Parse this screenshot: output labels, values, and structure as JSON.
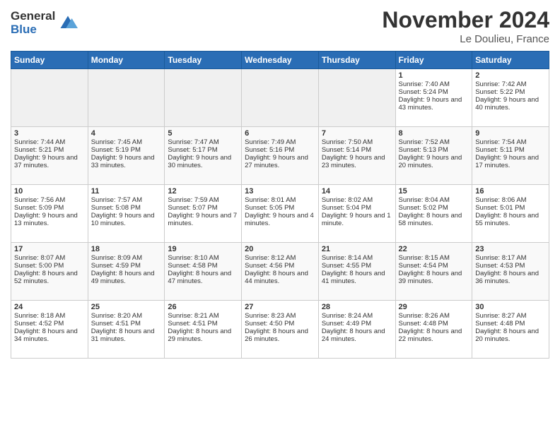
{
  "logo": {
    "general": "General",
    "blue": "Blue"
  },
  "header": {
    "month_year": "November 2024",
    "location": "Le Doulieu, France"
  },
  "days_of_week": [
    "Sunday",
    "Monday",
    "Tuesday",
    "Wednesday",
    "Thursday",
    "Friday",
    "Saturday"
  ],
  "weeks": [
    [
      {
        "day": "",
        "sunrise": "",
        "sunset": "",
        "daylight": "",
        "empty": true
      },
      {
        "day": "",
        "sunrise": "",
        "sunset": "",
        "daylight": "",
        "empty": true
      },
      {
        "day": "",
        "sunrise": "",
        "sunset": "",
        "daylight": "",
        "empty": true
      },
      {
        "day": "",
        "sunrise": "",
        "sunset": "",
        "daylight": "",
        "empty": true
      },
      {
        "day": "",
        "sunrise": "",
        "sunset": "",
        "daylight": "",
        "empty": true
      },
      {
        "day": "1",
        "sunrise": "Sunrise: 7:40 AM",
        "sunset": "Sunset: 5:24 PM",
        "daylight": "Daylight: 9 hours and 43 minutes.",
        "empty": false
      },
      {
        "day": "2",
        "sunrise": "Sunrise: 7:42 AM",
        "sunset": "Sunset: 5:22 PM",
        "daylight": "Daylight: 9 hours and 40 minutes.",
        "empty": false
      }
    ],
    [
      {
        "day": "3",
        "sunrise": "Sunrise: 7:44 AM",
        "sunset": "Sunset: 5:21 PM",
        "daylight": "Daylight: 9 hours and 37 minutes.",
        "empty": false
      },
      {
        "day": "4",
        "sunrise": "Sunrise: 7:45 AM",
        "sunset": "Sunset: 5:19 PM",
        "daylight": "Daylight: 9 hours and 33 minutes.",
        "empty": false
      },
      {
        "day": "5",
        "sunrise": "Sunrise: 7:47 AM",
        "sunset": "Sunset: 5:17 PM",
        "daylight": "Daylight: 9 hours and 30 minutes.",
        "empty": false
      },
      {
        "day": "6",
        "sunrise": "Sunrise: 7:49 AM",
        "sunset": "Sunset: 5:16 PM",
        "daylight": "Daylight: 9 hours and 27 minutes.",
        "empty": false
      },
      {
        "day": "7",
        "sunrise": "Sunrise: 7:50 AM",
        "sunset": "Sunset: 5:14 PM",
        "daylight": "Daylight: 9 hours and 23 minutes.",
        "empty": false
      },
      {
        "day": "8",
        "sunrise": "Sunrise: 7:52 AM",
        "sunset": "Sunset: 5:13 PM",
        "daylight": "Daylight: 9 hours and 20 minutes.",
        "empty": false
      },
      {
        "day": "9",
        "sunrise": "Sunrise: 7:54 AM",
        "sunset": "Sunset: 5:11 PM",
        "daylight": "Daylight: 9 hours and 17 minutes.",
        "empty": false
      }
    ],
    [
      {
        "day": "10",
        "sunrise": "Sunrise: 7:56 AM",
        "sunset": "Sunset: 5:09 PM",
        "daylight": "Daylight: 9 hours and 13 minutes.",
        "empty": false
      },
      {
        "day": "11",
        "sunrise": "Sunrise: 7:57 AM",
        "sunset": "Sunset: 5:08 PM",
        "daylight": "Daylight: 9 hours and 10 minutes.",
        "empty": false
      },
      {
        "day": "12",
        "sunrise": "Sunrise: 7:59 AM",
        "sunset": "Sunset: 5:07 PM",
        "daylight": "Daylight: 9 hours and 7 minutes.",
        "empty": false
      },
      {
        "day": "13",
        "sunrise": "Sunrise: 8:01 AM",
        "sunset": "Sunset: 5:05 PM",
        "daylight": "Daylight: 9 hours and 4 minutes.",
        "empty": false
      },
      {
        "day": "14",
        "sunrise": "Sunrise: 8:02 AM",
        "sunset": "Sunset: 5:04 PM",
        "daylight": "Daylight: 9 hours and 1 minute.",
        "empty": false
      },
      {
        "day": "15",
        "sunrise": "Sunrise: 8:04 AM",
        "sunset": "Sunset: 5:02 PM",
        "daylight": "Daylight: 8 hours and 58 minutes.",
        "empty": false
      },
      {
        "day": "16",
        "sunrise": "Sunrise: 8:06 AM",
        "sunset": "Sunset: 5:01 PM",
        "daylight": "Daylight: 8 hours and 55 minutes.",
        "empty": false
      }
    ],
    [
      {
        "day": "17",
        "sunrise": "Sunrise: 8:07 AM",
        "sunset": "Sunset: 5:00 PM",
        "daylight": "Daylight: 8 hours and 52 minutes.",
        "empty": false
      },
      {
        "day": "18",
        "sunrise": "Sunrise: 8:09 AM",
        "sunset": "Sunset: 4:59 PM",
        "daylight": "Daylight: 8 hours and 49 minutes.",
        "empty": false
      },
      {
        "day": "19",
        "sunrise": "Sunrise: 8:10 AM",
        "sunset": "Sunset: 4:58 PM",
        "daylight": "Daylight: 8 hours and 47 minutes.",
        "empty": false
      },
      {
        "day": "20",
        "sunrise": "Sunrise: 8:12 AM",
        "sunset": "Sunset: 4:56 PM",
        "daylight": "Daylight: 8 hours and 44 minutes.",
        "empty": false
      },
      {
        "day": "21",
        "sunrise": "Sunrise: 8:14 AM",
        "sunset": "Sunset: 4:55 PM",
        "daylight": "Daylight: 8 hours and 41 minutes.",
        "empty": false
      },
      {
        "day": "22",
        "sunrise": "Sunrise: 8:15 AM",
        "sunset": "Sunset: 4:54 PM",
        "daylight": "Daylight: 8 hours and 39 minutes.",
        "empty": false
      },
      {
        "day": "23",
        "sunrise": "Sunrise: 8:17 AM",
        "sunset": "Sunset: 4:53 PM",
        "daylight": "Daylight: 8 hours and 36 minutes.",
        "empty": false
      }
    ],
    [
      {
        "day": "24",
        "sunrise": "Sunrise: 8:18 AM",
        "sunset": "Sunset: 4:52 PM",
        "daylight": "Daylight: 8 hours and 34 minutes.",
        "empty": false
      },
      {
        "day": "25",
        "sunrise": "Sunrise: 8:20 AM",
        "sunset": "Sunset: 4:51 PM",
        "daylight": "Daylight: 8 hours and 31 minutes.",
        "empty": false
      },
      {
        "day": "26",
        "sunrise": "Sunrise: 8:21 AM",
        "sunset": "Sunset: 4:51 PM",
        "daylight": "Daylight: 8 hours and 29 minutes.",
        "empty": false
      },
      {
        "day": "27",
        "sunrise": "Sunrise: 8:23 AM",
        "sunset": "Sunset: 4:50 PM",
        "daylight": "Daylight: 8 hours and 26 minutes.",
        "empty": false
      },
      {
        "day": "28",
        "sunrise": "Sunrise: 8:24 AM",
        "sunset": "Sunset: 4:49 PM",
        "daylight": "Daylight: 8 hours and 24 minutes.",
        "empty": false
      },
      {
        "day": "29",
        "sunrise": "Sunrise: 8:26 AM",
        "sunset": "Sunset: 4:48 PM",
        "daylight": "Daylight: 8 hours and 22 minutes.",
        "empty": false
      },
      {
        "day": "30",
        "sunrise": "Sunrise: 8:27 AM",
        "sunset": "Sunset: 4:48 PM",
        "daylight": "Daylight: 8 hours and 20 minutes.",
        "empty": false
      }
    ]
  ]
}
